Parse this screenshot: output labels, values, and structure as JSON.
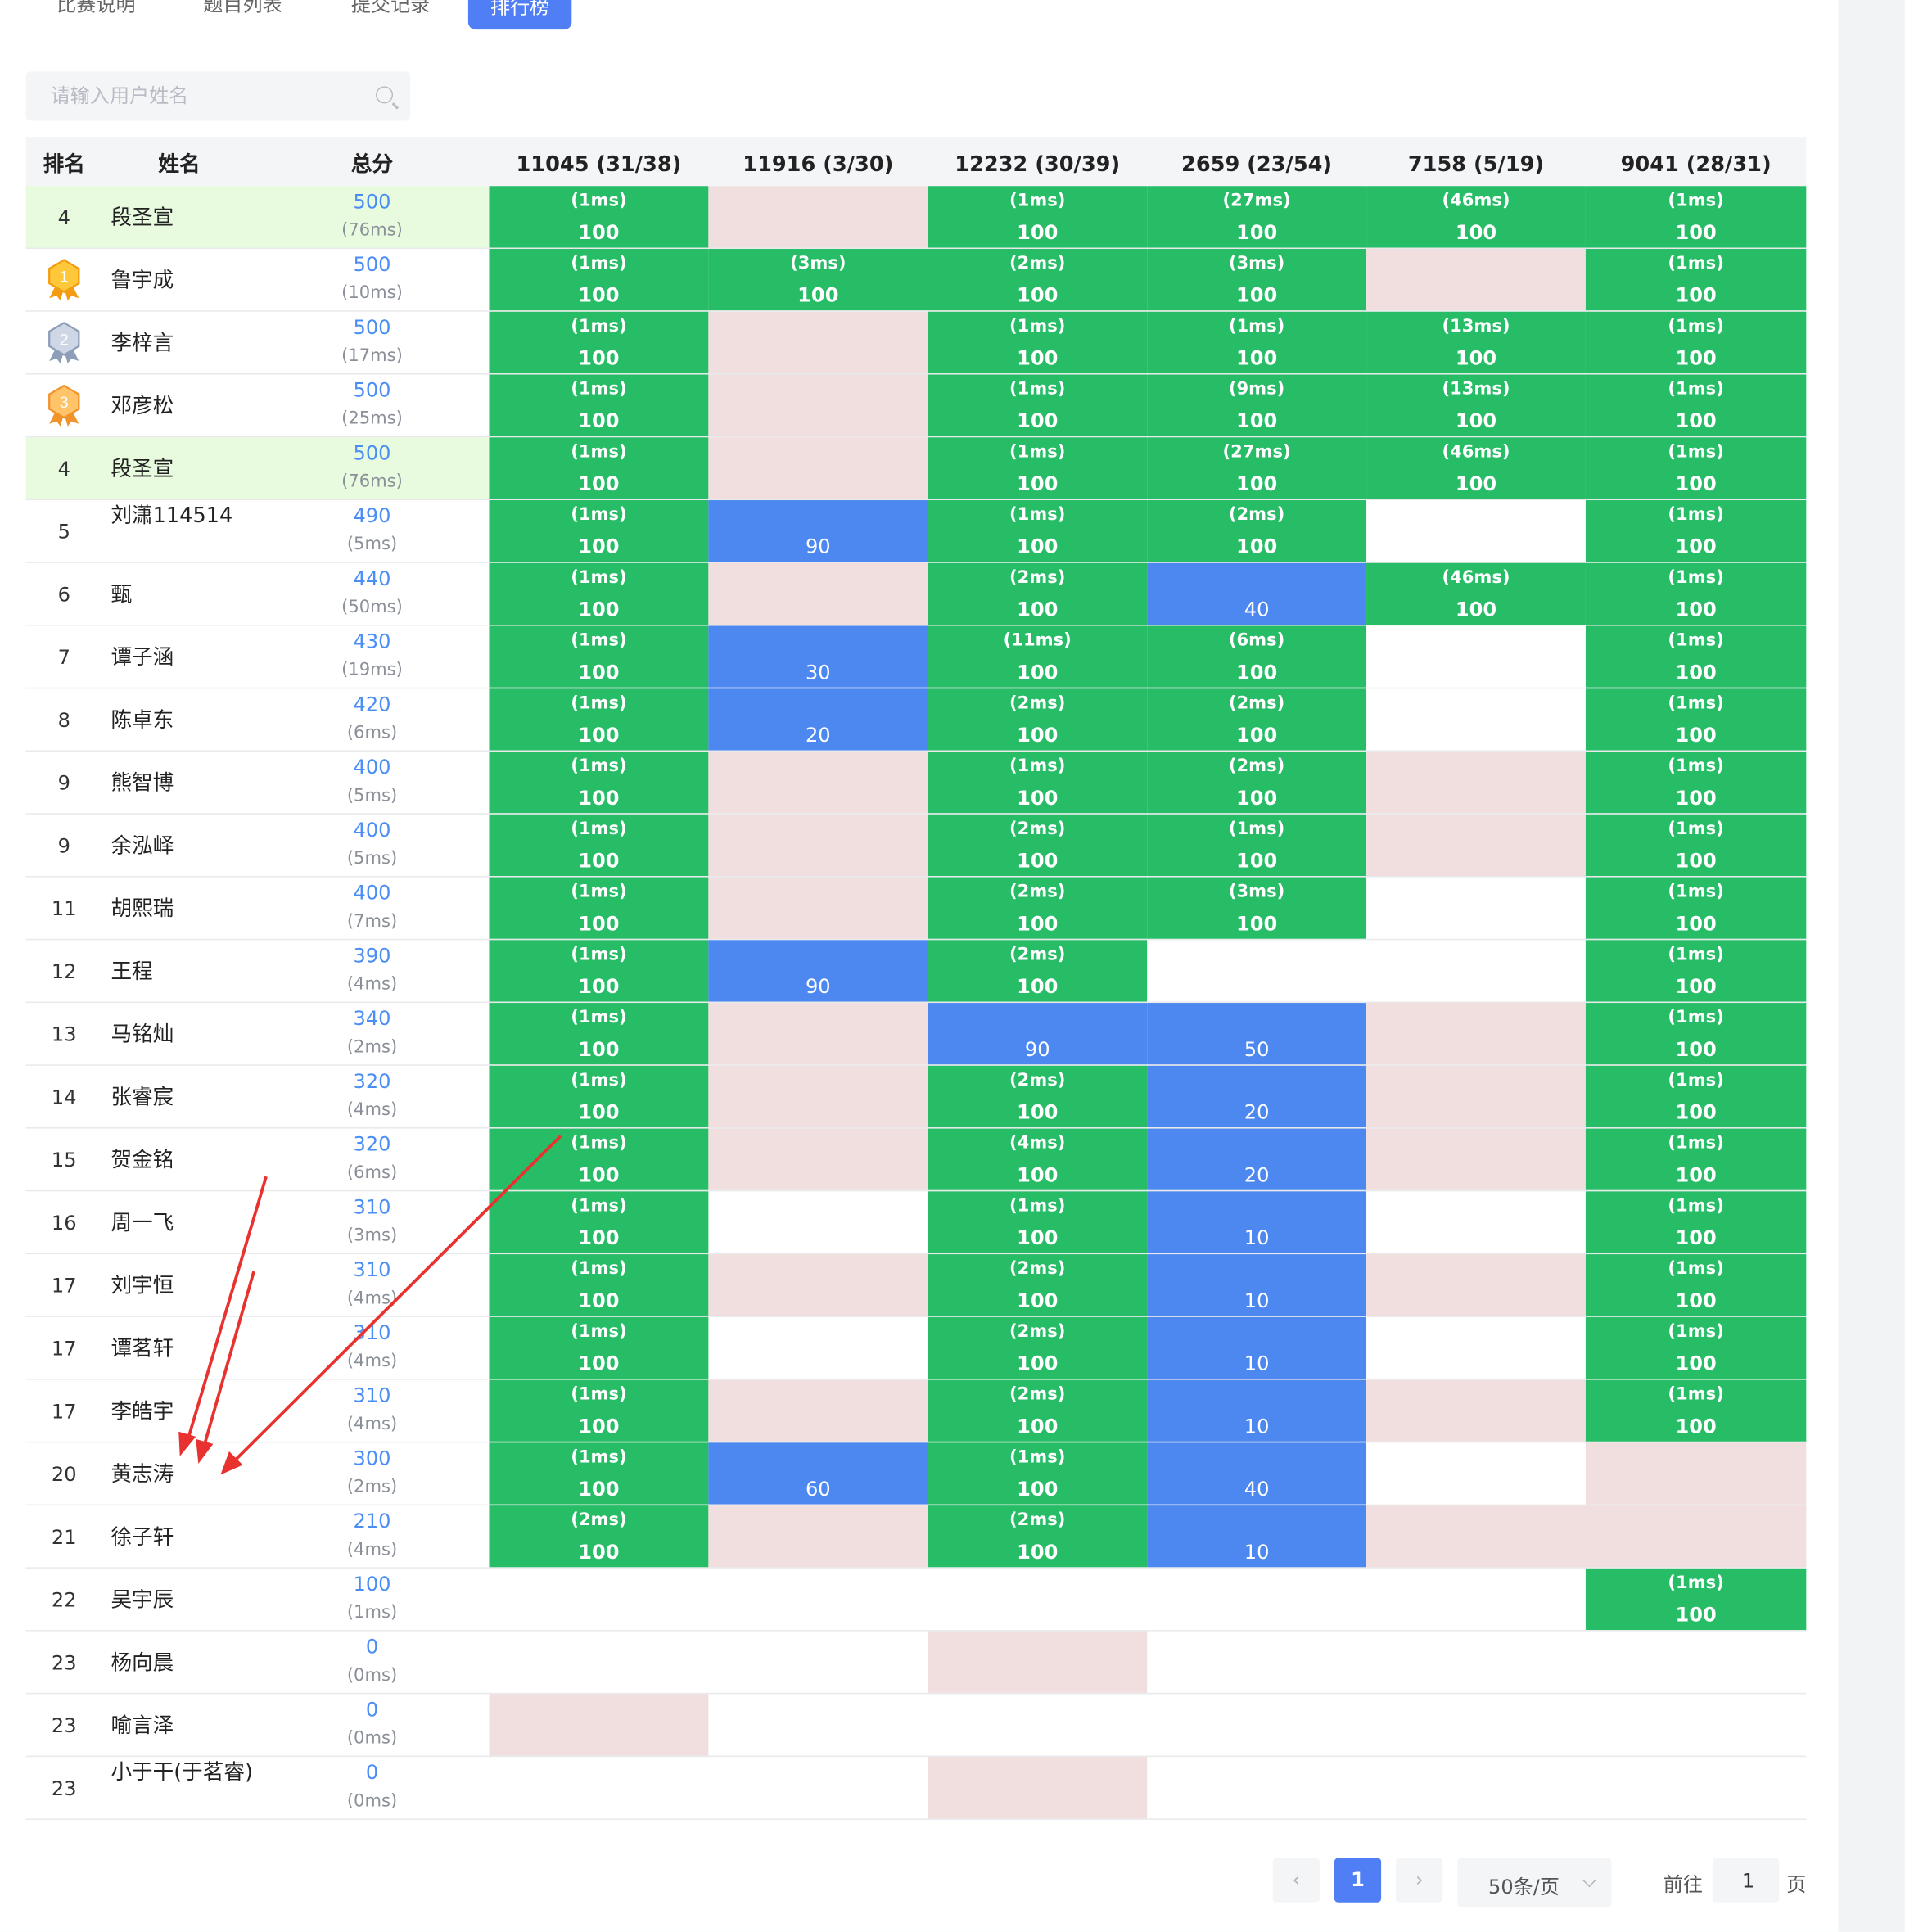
{
  "tabs": [
    {
      "label": "比赛说明",
      "active": false
    },
    {
      "label": "题目列表",
      "active": false
    },
    {
      "label": "提交记录",
      "active": false
    },
    {
      "label": "排行榜",
      "active": true
    }
  ],
  "search": {
    "placeholder": "请输入用户姓名",
    "value": ""
  },
  "table": {
    "headers": {
      "rank": "排名",
      "name": "姓名",
      "total": "总分"
    },
    "problems": [
      "11045 (31/38)",
      "11916 (3/30)",
      "12232 (30/39)",
      "2659 (23/54)",
      "7158 (5/19)",
      "9041 (28/31)"
    ],
    "rows": [
      {
        "rank": "4",
        "medal": "",
        "name": "段圣宣",
        "score": "500",
        "time": "(76ms)",
        "highlight": true,
        "cells": [
          [
            "g",
            "(1ms)",
            "100"
          ],
          [
            "p",
            "",
            ""
          ],
          [
            "g",
            "(1ms)",
            "100"
          ],
          [
            "g",
            "(27ms)",
            "100"
          ],
          [
            "g",
            "(46ms)",
            "100"
          ],
          [
            "g",
            "(1ms)",
            "100"
          ]
        ]
      },
      {
        "rank": "",
        "medal": "gold",
        "medal_num": "1",
        "name": "鲁宇成",
        "score": "500",
        "time": "(10ms)",
        "highlight": false,
        "cells": [
          [
            "g",
            "(1ms)",
            "100"
          ],
          [
            "g",
            "(3ms)",
            "100"
          ],
          [
            "g",
            "(2ms)",
            "100"
          ],
          [
            "g",
            "(3ms)",
            "100"
          ],
          [
            "p",
            "",
            ""
          ],
          [
            "g",
            "(1ms)",
            "100"
          ]
        ]
      },
      {
        "rank": "",
        "medal": "silver",
        "medal_num": "2",
        "name": "李梓言",
        "score": "500",
        "time": "(17ms)",
        "highlight": false,
        "cells": [
          [
            "g",
            "(1ms)",
            "100"
          ],
          [
            "p",
            "",
            ""
          ],
          [
            "g",
            "(1ms)",
            "100"
          ],
          [
            "g",
            "(1ms)",
            "100"
          ],
          [
            "g",
            "(13ms)",
            "100"
          ],
          [
            "g",
            "(1ms)",
            "100"
          ]
        ]
      },
      {
        "rank": "",
        "medal": "bronze",
        "medal_num": "3",
        "name": "邓彦松",
        "score": "500",
        "time": "(25ms)",
        "highlight": false,
        "cells": [
          [
            "g",
            "(1ms)",
            "100"
          ],
          [
            "p",
            "",
            ""
          ],
          [
            "g",
            "(1ms)",
            "100"
          ],
          [
            "g",
            "(9ms)",
            "100"
          ],
          [
            "g",
            "(13ms)",
            "100"
          ],
          [
            "g",
            "(1ms)",
            "100"
          ]
        ]
      },
      {
        "rank": "4",
        "medal": "",
        "name": "段圣宣",
        "score": "500",
        "time": "(76ms)",
        "highlight": true,
        "cells": [
          [
            "g",
            "(1ms)",
            "100"
          ],
          [
            "p",
            "",
            ""
          ],
          [
            "g",
            "(1ms)",
            "100"
          ],
          [
            "g",
            "(27ms)",
            "100"
          ],
          [
            "g",
            "(46ms)",
            "100"
          ],
          [
            "g",
            "(1ms)",
            "100"
          ]
        ]
      },
      {
        "rank": "5",
        "medal": "",
        "name": "刘潇114514",
        "score": "490",
        "time": "(5ms)",
        "highlight": false,
        "cells": [
          [
            "g",
            "(1ms)",
            "100"
          ],
          [
            "b",
            "",
            "90"
          ],
          [
            "g",
            "(1ms)",
            "100"
          ],
          [
            "g",
            "(2ms)",
            "100"
          ],
          [
            "w",
            "",
            ""
          ],
          [
            "g",
            "(1ms)",
            "100"
          ]
        ]
      },
      {
        "rank": "6",
        "medal": "",
        "name": "甄",
        "score": "440",
        "time": "(50ms)",
        "highlight": false,
        "cells": [
          [
            "g",
            "(1ms)",
            "100"
          ],
          [
            "p",
            "",
            ""
          ],
          [
            "g",
            "(2ms)",
            "100"
          ],
          [
            "b",
            "",
            "40"
          ],
          [
            "g",
            "(46ms)",
            "100"
          ],
          [
            "g",
            "(1ms)",
            "100"
          ]
        ]
      },
      {
        "rank": "7",
        "medal": "",
        "name": "谭子涵",
        "score": "430",
        "time": "(19ms)",
        "highlight": false,
        "cells": [
          [
            "g",
            "(1ms)",
            "100"
          ],
          [
            "b",
            "",
            "30"
          ],
          [
            "g",
            "(11ms)",
            "100"
          ],
          [
            "g",
            "(6ms)",
            "100"
          ],
          [
            "w",
            "",
            ""
          ],
          [
            "g",
            "(1ms)",
            "100"
          ]
        ]
      },
      {
        "rank": "8",
        "medal": "",
        "name": "陈卓东",
        "score": "420",
        "time": "(6ms)",
        "highlight": false,
        "cells": [
          [
            "g",
            "(1ms)",
            "100"
          ],
          [
            "b",
            "",
            "20"
          ],
          [
            "g",
            "(2ms)",
            "100"
          ],
          [
            "g",
            "(2ms)",
            "100"
          ],
          [
            "w",
            "",
            ""
          ],
          [
            "g",
            "(1ms)",
            "100"
          ]
        ]
      },
      {
        "rank": "9",
        "medal": "",
        "name": "熊智博",
        "score": "400",
        "time": "(5ms)",
        "highlight": false,
        "cells": [
          [
            "g",
            "(1ms)",
            "100"
          ],
          [
            "p",
            "",
            ""
          ],
          [
            "g",
            "(1ms)",
            "100"
          ],
          [
            "g",
            "(2ms)",
            "100"
          ],
          [
            "p",
            "",
            ""
          ],
          [
            "g",
            "(1ms)",
            "100"
          ]
        ]
      },
      {
        "rank": "9",
        "medal": "",
        "name": "余泓峄",
        "score": "400",
        "time": "(5ms)",
        "highlight": false,
        "cells": [
          [
            "g",
            "(1ms)",
            "100"
          ],
          [
            "p",
            "",
            ""
          ],
          [
            "g",
            "(2ms)",
            "100"
          ],
          [
            "g",
            "(1ms)",
            "100"
          ],
          [
            "p",
            "",
            ""
          ],
          [
            "g",
            "(1ms)",
            "100"
          ]
        ]
      },
      {
        "rank": "11",
        "medal": "",
        "name": "胡熙瑞",
        "score": "400",
        "time": "(7ms)",
        "highlight": false,
        "cells": [
          [
            "g",
            "(1ms)",
            "100"
          ],
          [
            "p",
            "",
            ""
          ],
          [
            "g",
            "(2ms)",
            "100"
          ],
          [
            "g",
            "(3ms)",
            "100"
          ],
          [
            "w",
            "",
            ""
          ],
          [
            "g",
            "(1ms)",
            "100"
          ]
        ]
      },
      {
        "rank": "12",
        "medal": "",
        "name": "王程",
        "score": "390",
        "time": "(4ms)",
        "highlight": false,
        "cells": [
          [
            "g",
            "(1ms)",
            "100"
          ],
          [
            "b",
            "",
            "90"
          ],
          [
            "g",
            "(2ms)",
            "100"
          ],
          [
            "w",
            "",
            ""
          ],
          [
            "w",
            "",
            ""
          ],
          [
            "g",
            "(1ms)",
            "100"
          ]
        ]
      },
      {
        "rank": "13",
        "medal": "",
        "name": "马铭灿",
        "score": "340",
        "time": "(2ms)",
        "highlight": false,
        "cells": [
          [
            "g",
            "(1ms)",
            "100"
          ],
          [
            "p",
            "",
            ""
          ],
          [
            "b",
            "",
            "90"
          ],
          [
            "b",
            "",
            "50"
          ],
          [
            "p",
            "",
            ""
          ],
          [
            "g",
            "(1ms)",
            "100"
          ]
        ]
      },
      {
        "rank": "14",
        "medal": "",
        "name": "张睿宸",
        "score": "320",
        "time": "(4ms)",
        "highlight": false,
        "cells": [
          [
            "g",
            "(1ms)",
            "100"
          ],
          [
            "p",
            "",
            ""
          ],
          [
            "g",
            "(2ms)",
            "100"
          ],
          [
            "b",
            "",
            "20"
          ],
          [
            "p",
            "",
            ""
          ],
          [
            "g",
            "(1ms)",
            "100"
          ]
        ]
      },
      {
        "rank": "15",
        "medal": "",
        "name": "贺金铭",
        "score": "320",
        "time": "(6ms)",
        "highlight": false,
        "cells": [
          [
            "g",
            "(1ms)",
            "100"
          ],
          [
            "p",
            "",
            ""
          ],
          [
            "g",
            "(4ms)",
            "100"
          ],
          [
            "b",
            "",
            "20"
          ],
          [
            "p",
            "",
            ""
          ],
          [
            "g",
            "(1ms)",
            "100"
          ]
        ]
      },
      {
        "rank": "16",
        "medal": "",
        "name": "周一飞",
        "score": "310",
        "time": "(3ms)",
        "highlight": false,
        "cells": [
          [
            "g",
            "(1ms)",
            "100"
          ],
          [
            "w",
            "",
            ""
          ],
          [
            "g",
            "(1ms)",
            "100"
          ],
          [
            "b",
            "",
            "10"
          ],
          [
            "w",
            "",
            ""
          ],
          [
            "g",
            "(1ms)",
            "100"
          ]
        ]
      },
      {
        "rank": "17",
        "medal": "",
        "name": "刘宇恒",
        "score": "310",
        "time": "(4ms)",
        "highlight": false,
        "cells": [
          [
            "g",
            "(1ms)",
            "100"
          ],
          [
            "p",
            "",
            ""
          ],
          [
            "g",
            "(2ms)",
            "100"
          ],
          [
            "b",
            "",
            "10"
          ],
          [
            "p",
            "",
            ""
          ],
          [
            "g",
            "(1ms)",
            "100"
          ]
        ]
      },
      {
        "rank": "17",
        "medal": "",
        "name": "谭茗轩",
        "score": "310",
        "time": "(4ms)",
        "highlight": false,
        "cells": [
          [
            "g",
            "(1ms)",
            "100"
          ],
          [
            "w",
            "",
            ""
          ],
          [
            "g",
            "(2ms)",
            "100"
          ],
          [
            "b",
            "",
            "10"
          ],
          [
            "w",
            "",
            ""
          ],
          [
            "g",
            "(1ms)",
            "100"
          ]
        ]
      },
      {
        "rank": "17",
        "medal": "",
        "name": "李皓宇",
        "score": "310",
        "time": "(4ms)",
        "highlight": false,
        "cells": [
          [
            "g",
            "(1ms)",
            "100"
          ],
          [
            "p",
            "",
            ""
          ],
          [
            "g",
            "(2ms)",
            "100"
          ],
          [
            "b",
            "",
            "10"
          ],
          [
            "p",
            "",
            ""
          ],
          [
            "g",
            "(1ms)",
            "100"
          ]
        ]
      },
      {
        "rank": "20",
        "medal": "",
        "name": "黄志涛",
        "score": "300",
        "time": "(2ms)",
        "highlight": false,
        "cells": [
          [
            "g",
            "(1ms)",
            "100"
          ],
          [
            "b",
            "",
            "60"
          ],
          [
            "g",
            "(1ms)",
            "100"
          ],
          [
            "b",
            "",
            "40"
          ],
          [
            "w",
            "",
            ""
          ],
          [
            "p",
            "",
            ""
          ]
        ]
      },
      {
        "rank": "21",
        "medal": "",
        "name": "徐子轩",
        "score": "210",
        "time": "(4ms)",
        "highlight": false,
        "cells": [
          [
            "g",
            "(2ms)",
            "100"
          ],
          [
            "p",
            "",
            ""
          ],
          [
            "g",
            "(2ms)",
            "100"
          ],
          [
            "b",
            "",
            "10"
          ],
          [
            "p",
            "",
            ""
          ],
          [
            "p",
            "",
            ""
          ]
        ]
      },
      {
        "rank": "22",
        "medal": "",
        "name": "吴宇辰",
        "score": "100",
        "time": "(1ms)",
        "highlight": false,
        "cells": [
          [
            "w",
            "",
            ""
          ],
          [
            "w",
            "",
            ""
          ],
          [
            "w",
            "",
            ""
          ],
          [
            "w",
            "",
            ""
          ],
          [
            "w",
            "",
            ""
          ],
          [
            "g",
            "(1ms)",
            "100"
          ]
        ]
      },
      {
        "rank": "23",
        "medal": "",
        "name": "杨向晨",
        "score": "0",
        "time": "(0ms)",
        "highlight": false,
        "cells": [
          [
            "w",
            "",
            ""
          ],
          [
            "w",
            "",
            ""
          ],
          [
            "p",
            "",
            ""
          ],
          [
            "w",
            "",
            ""
          ],
          [
            "w",
            "",
            ""
          ],
          [
            "w",
            "",
            ""
          ]
        ]
      },
      {
        "rank": "23",
        "medal": "",
        "name": "喻言泽",
        "score": "0",
        "time": "(0ms)",
        "highlight": false,
        "cells": [
          [
            "p",
            "",
            ""
          ],
          [
            "w",
            "",
            ""
          ],
          [
            "w",
            "",
            ""
          ],
          [
            "w",
            "",
            ""
          ],
          [
            "w",
            "",
            ""
          ],
          [
            "w",
            "",
            ""
          ]
        ]
      },
      {
        "rank": "23",
        "medal": "",
        "name": "小于干(于茗睿)",
        "score": "0",
        "time": "(0ms)",
        "highlight": false,
        "cells": [
          [
            "w",
            "",
            ""
          ],
          [
            "w",
            "",
            ""
          ],
          [
            "p",
            "",
            ""
          ],
          [
            "w",
            "",
            ""
          ],
          [
            "w",
            "",
            ""
          ],
          [
            "w",
            "",
            ""
          ]
        ]
      }
    ]
  },
  "pagination": {
    "prev_icon": "chevron-left-icon",
    "next_icon": "chevron-right-icon",
    "current_page": "1",
    "page_size": "50条/页",
    "goto_label": "前往",
    "goto_value": "1",
    "page_suffix": "页"
  },
  "colors": {
    "accepted": "#27bd67",
    "partial": "#4c88ef",
    "wrong": "#f1dfdf",
    "highlight_row": "#e8fbdf",
    "accent": "#4f7ef5",
    "annotation_arrow": "#e8322f"
  }
}
